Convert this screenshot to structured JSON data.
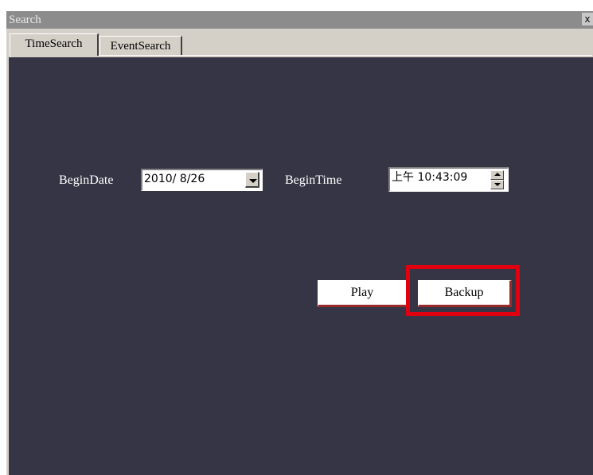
{
  "window": {
    "title": "Search",
    "close_glyph": "x"
  },
  "tabs": [
    {
      "label": "TimeSearch",
      "active": true
    },
    {
      "label": "EventSearch",
      "active": false
    }
  ],
  "form": {
    "begin_date_label": "BeginDate",
    "begin_date_value": "2010/ 8/26",
    "begin_time_label": "BeginTime",
    "begin_time_value": "上午 10:43:09"
  },
  "buttons": {
    "play_label": "Play",
    "backup_label": "Backup"
  },
  "colors": {
    "panel_bg": "#363545",
    "highlight": "#e0000f",
    "titlebar": "#8c8c8c"
  },
  "icons": [
    "close-icon",
    "dropdown-arrow-icon",
    "spinner-up-icon",
    "spinner-down-icon"
  ]
}
